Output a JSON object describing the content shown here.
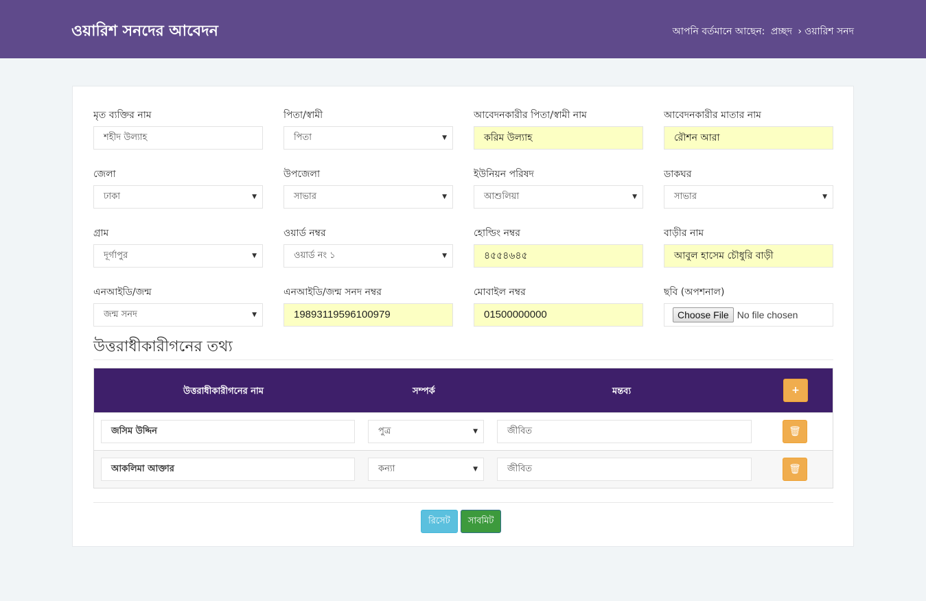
{
  "header": {
    "title": "ওয়ারিশ সনদের আবেদন",
    "breadcrumb_prefix": "আপনি বর্তমানে আছেন:",
    "breadcrumb_home": "প্রচ্ছদ",
    "breadcrumb_sep": "›",
    "breadcrumb_current": "ওয়ারিশ সনদ"
  },
  "form": {
    "fields": [
      {
        "label": "মৃত ব্যক্তির নাম",
        "value": "শহীদ উল্যাহ"
      },
      {
        "label": "পিতা/স্বামী",
        "value": "পিতা"
      },
      {
        "label": "আবেদনকারীর পিতা/স্বামী নাম",
        "value": "করিম উল্যাহ"
      },
      {
        "label": "আবেদনকারীর মাতার নাম",
        "value": "রৌশন আরা"
      },
      {
        "label": "জেলা",
        "value": "ঢাকা"
      },
      {
        "label": "উপজেলা",
        "value": "সাভার"
      },
      {
        "label": "ইউনিয়ন পরিষদ",
        "value": "আশুলিয়া"
      },
      {
        "label": "ডাকঘর",
        "value": "সাভার"
      },
      {
        "label": "গ্রাম",
        "value": "দূর্গাপুর"
      },
      {
        "label": "ওয়ার্ড নম্বর",
        "value": "ওয়ার্ড নং ১"
      },
      {
        "label": "হোল্ডিং নম্বর",
        "value": "৪৫৫৪৬৪৫"
      },
      {
        "label": "বাড়ীর নাম",
        "value": "আবুল হাসেম চৌধুরি বাড়ী"
      },
      {
        "label": "এনআইডি/জন্ম",
        "value": "জন্ম সনদ"
      },
      {
        "label": "এনআইডি/জন্ম সনদ নম্বর",
        "value": "19893119596100979"
      },
      {
        "label": "মোবাইল নম্বর",
        "value": "01500000000"
      },
      {
        "label": "ছবি (অপশনাল)",
        "button": "Choose File",
        "status": "No file chosen"
      }
    ]
  },
  "heirs": {
    "title": "উত্তরাধীকারীগনের তথ্য",
    "headers": [
      "উত্তরাধীকারীগনের নাম",
      "সম্পর্ক",
      "মন্তব্য"
    ],
    "add": "+",
    "rows": [
      {
        "name": "জসিম উদ্দিন",
        "relation": "পুত্র",
        "remark": "জীবিত"
      },
      {
        "name": "আকলিমা আক্তার",
        "relation": "কন্যা",
        "remark": "জীবিত"
      }
    ]
  },
  "actions": {
    "reset": "রিসেট",
    "submit": "সাবমিট"
  }
}
